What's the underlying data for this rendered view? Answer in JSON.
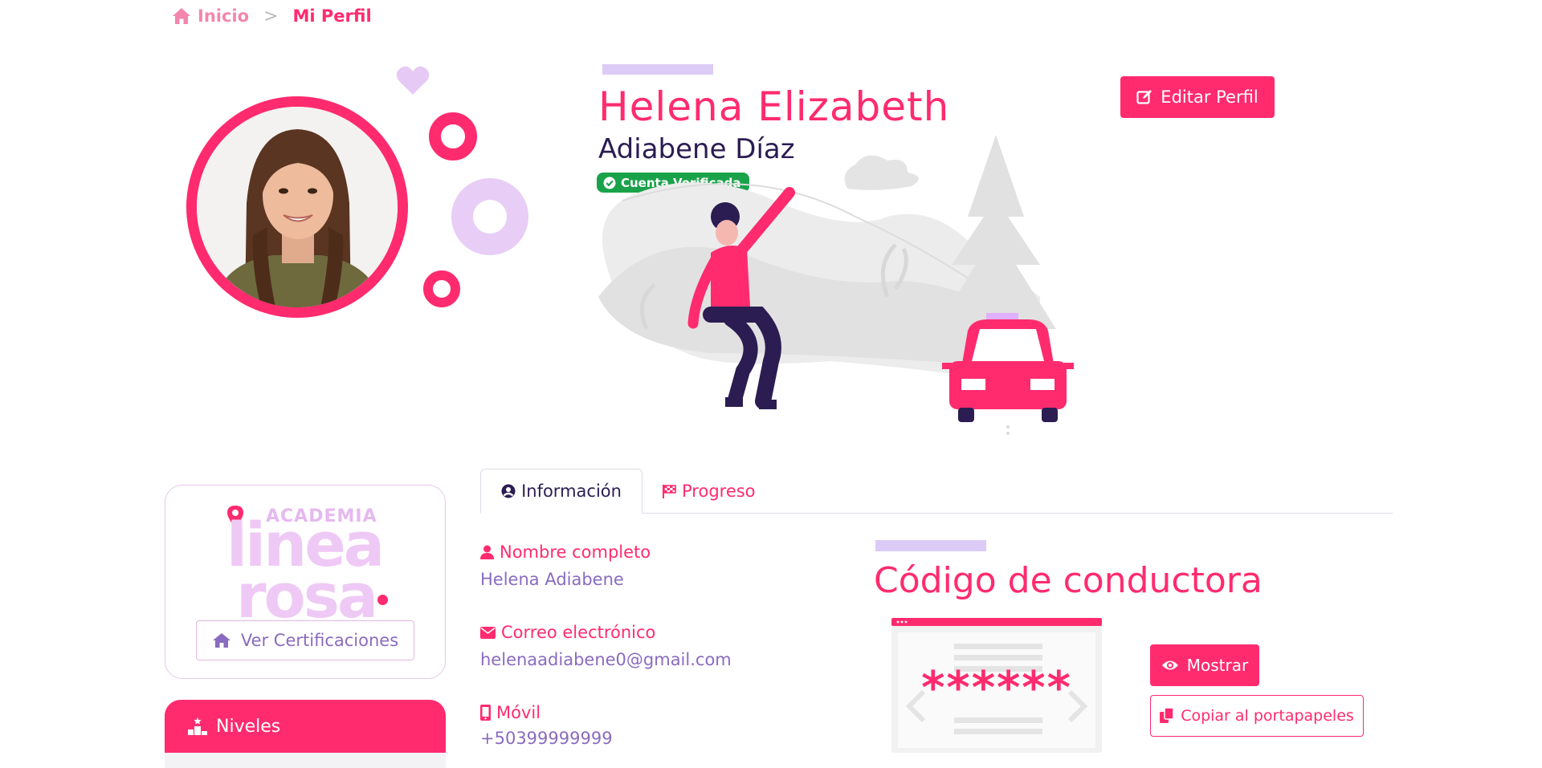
{
  "breadcrumb": {
    "home_label": "Inicio",
    "current_label": "Mi Perfil",
    "separator": ">"
  },
  "profile": {
    "first_name": "Helena Elizabeth",
    "last_name": "Adiabene Díaz",
    "verified_label": "Cuenta Verificada",
    "edit_button": "Editar Perfil"
  },
  "sidebar": {
    "logo_top": "ACADEMIA",
    "logo_line1": "linea",
    "logo_line2": "rosa",
    "certifications_button": "Ver Certificaciones",
    "levels_label": "Niveles"
  },
  "tabs": [
    {
      "label": "Información",
      "active": true
    },
    {
      "label": "Progreso",
      "active": false
    }
  ],
  "info": {
    "name_label": "Nombre completo",
    "name_value": "Helena Adiabene",
    "email_label": "Correo electrónico",
    "email_value": "helenaadiabene0@gmail.com",
    "phone_label": "Móvil",
    "phone_value": "+50399999999"
  },
  "driver_code": {
    "title": "Código de conductora",
    "masked_value": "******",
    "show_button": "Mostrar",
    "copy_button": "Copiar al portapapeles"
  },
  "colors": {
    "primary": "#ff2b6e",
    "accent_lilac": "#dccbf6",
    "text_purple": "#8a6bbf",
    "dark_navy": "#2b1d52",
    "verified_green": "#1aa24a"
  }
}
